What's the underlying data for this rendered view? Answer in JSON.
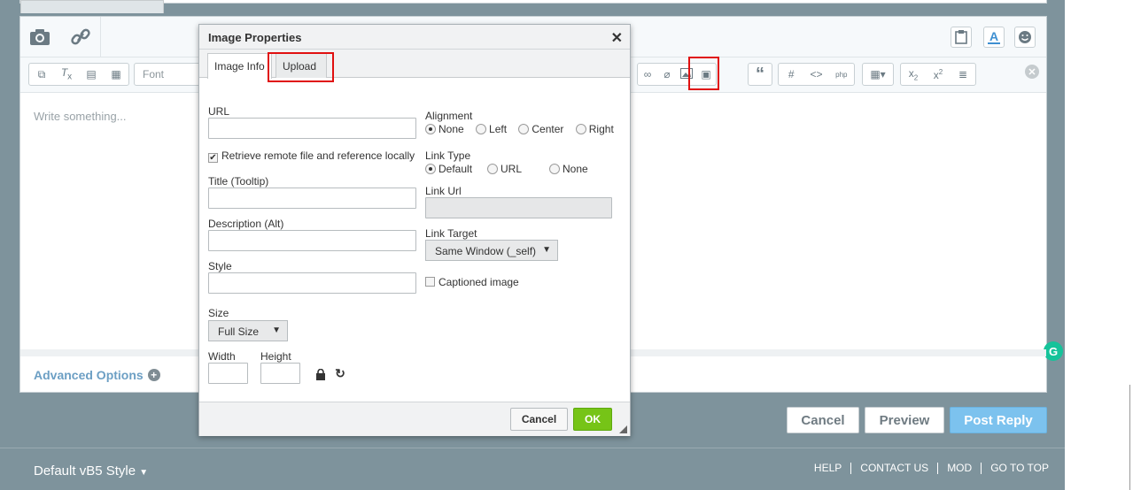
{
  "editor": {
    "placeholder": "Write something...",
    "font_label": "Font",
    "advanced_options": "Advanced Options",
    "toolbar_icons": [
      "camera-icon",
      "link-icon",
      "paste-icon",
      "emoticon-icon"
    ]
  },
  "actions": {
    "cancel": "Cancel",
    "preview": "Preview",
    "post_reply": "Post Reply"
  },
  "footer": {
    "style_selector": "Default vB5 Style",
    "links": [
      "HELP",
      "CONTACT US",
      "MOD",
      "GO TO TOP"
    ]
  },
  "dialog": {
    "title": "Image Properties",
    "tabs": [
      "Image Info",
      "Upload"
    ],
    "url_label": "URL",
    "retrieve_label": "Retrieve remote file and reference locally",
    "retrieve_checked": true,
    "title_label": "Title (Tooltip)",
    "description_label": "Description (Alt)",
    "style_label": "Style",
    "size_label": "Size",
    "size_value": "Full Size",
    "width_label": "Width",
    "height_label": "Height",
    "alignment_label": "Alignment",
    "alignment_options": [
      "None",
      "Left",
      "Center",
      "Right"
    ],
    "alignment_selected": "None",
    "link_type_label": "Link Type",
    "link_type_options": [
      "Default",
      "URL",
      "None"
    ],
    "link_type_selected": "Default",
    "link_url_label": "Link Url",
    "link_target_label": "Link Target",
    "link_target_value": "Same Window (_self)",
    "captioned_label": "Captioned image",
    "cancel": "Cancel",
    "ok": "OK"
  },
  "colors": {
    "ok_button": "#76c417",
    "post_reply": "#7cc2ee",
    "highlight": "#e01010",
    "grammarly": "#15c39a"
  }
}
